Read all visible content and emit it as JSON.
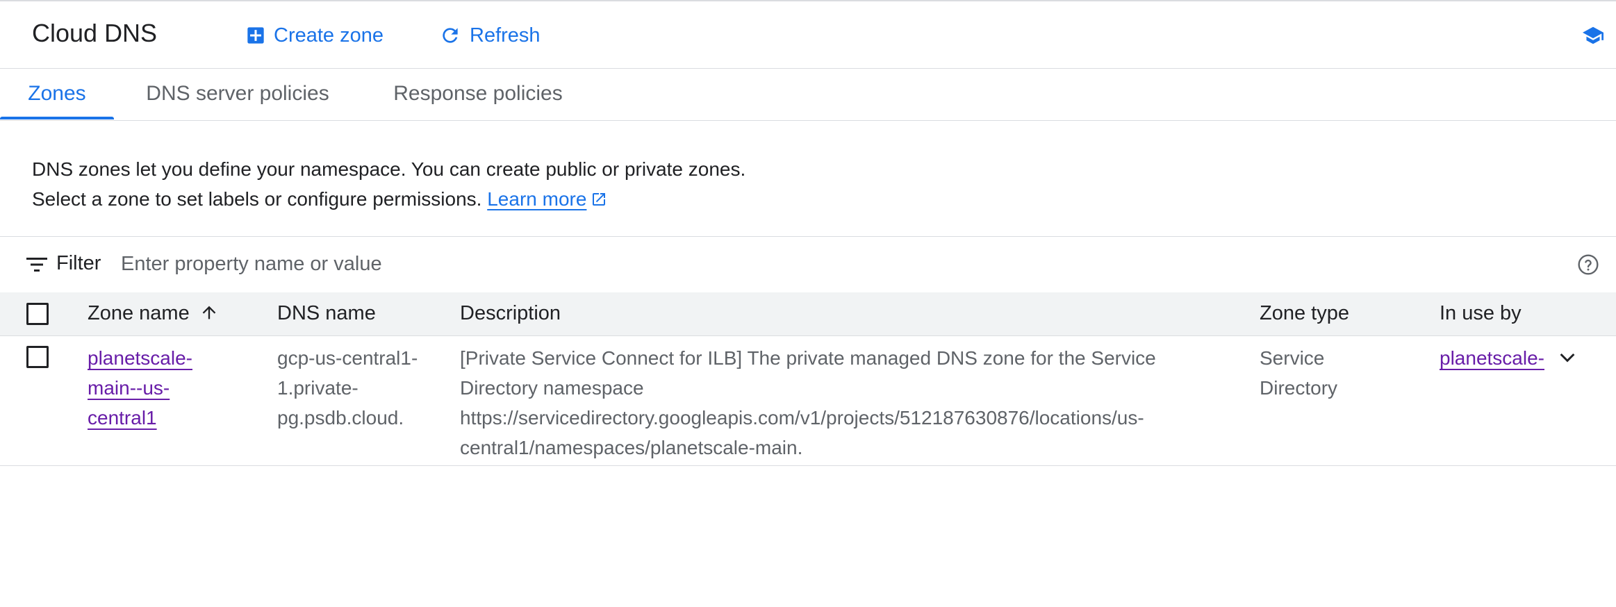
{
  "header": {
    "title": "Cloud DNS",
    "create_zone_label": "Create zone",
    "refresh_label": "Refresh",
    "accent_color": "#1a73e8"
  },
  "tabs": [
    {
      "label": "Zones",
      "active": true
    },
    {
      "label": "DNS server policies",
      "active": false
    },
    {
      "label": "Response policies",
      "active": false
    }
  ],
  "intro": {
    "text": "DNS zones let you define your namespace. You can create public or private zones. Select a zone to set labels or configure permissions.",
    "link_label": "Learn more"
  },
  "filter": {
    "label": "Filter",
    "placeholder": "Enter property name or value"
  },
  "table": {
    "columns": [
      "Zone name",
      "DNS name",
      "Description",
      "Zone type",
      "In use by"
    ],
    "sorted_column": "Zone name",
    "sort_direction": "ascending",
    "rows": [
      {
        "zone_name": "planetscale-main--us-central1",
        "dns_name": "gcp-us-central1-1.private-pg.psdb.cloud.",
        "description": "[Private Service Connect for ILB] The private managed DNS zone for the Service Directory namespace https://servicedirectory.googleapis.com/v1/projects/512187630876/locations/us-central1/namespaces/planetscale-main.",
        "zone_type": "Service Directory",
        "in_use_by": "planetscale-"
      }
    ]
  },
  "icons": {
    "create": "add-box-icon",
    "refresh": "refresh-icon",
    "learn": "school-icon",
    "external": "external-link-icon",
    "filter": "filter-list-icon",
    "help": "help-icon",
    "sort": "arrow-upward-icon",
    "expand": "chevron-down-icon"
  },
  "colors": {
    "visited_link": "#681da8",
    "header_bg": "#f1f3f4",
    "border": "#dadce0"
  }
}
